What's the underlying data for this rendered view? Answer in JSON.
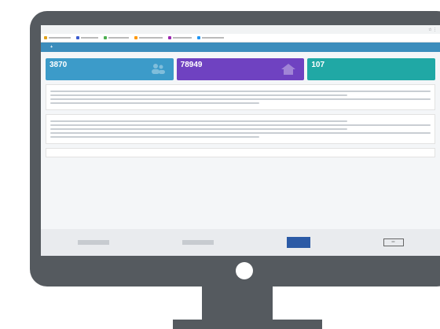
{
  "browser": {
    "url": "",
    "bookmarks": []
  },
  "app": {
    "nav_title": "",
    "page_heading": ""
  },
  "tiles": [
    {
      "value": "3870",
      "label": "",
      "color": "#3c9bc9"
    },
    {
      "value": "78949",
      "label": "",
      "color": "#6f42c1"
    },
    {
      "value": "107",
      "label": "",
      "color": "#20a8a5"
    }
  ],
  "cards": [
    {
      "title": ""
    },
    {
      "title": ""
    }
  ],
  "faq": {
    "label": ""
  },
  "colors": {
    "frame": "#555a5f",
    "nav": "#3c8dbc"
  }
}
